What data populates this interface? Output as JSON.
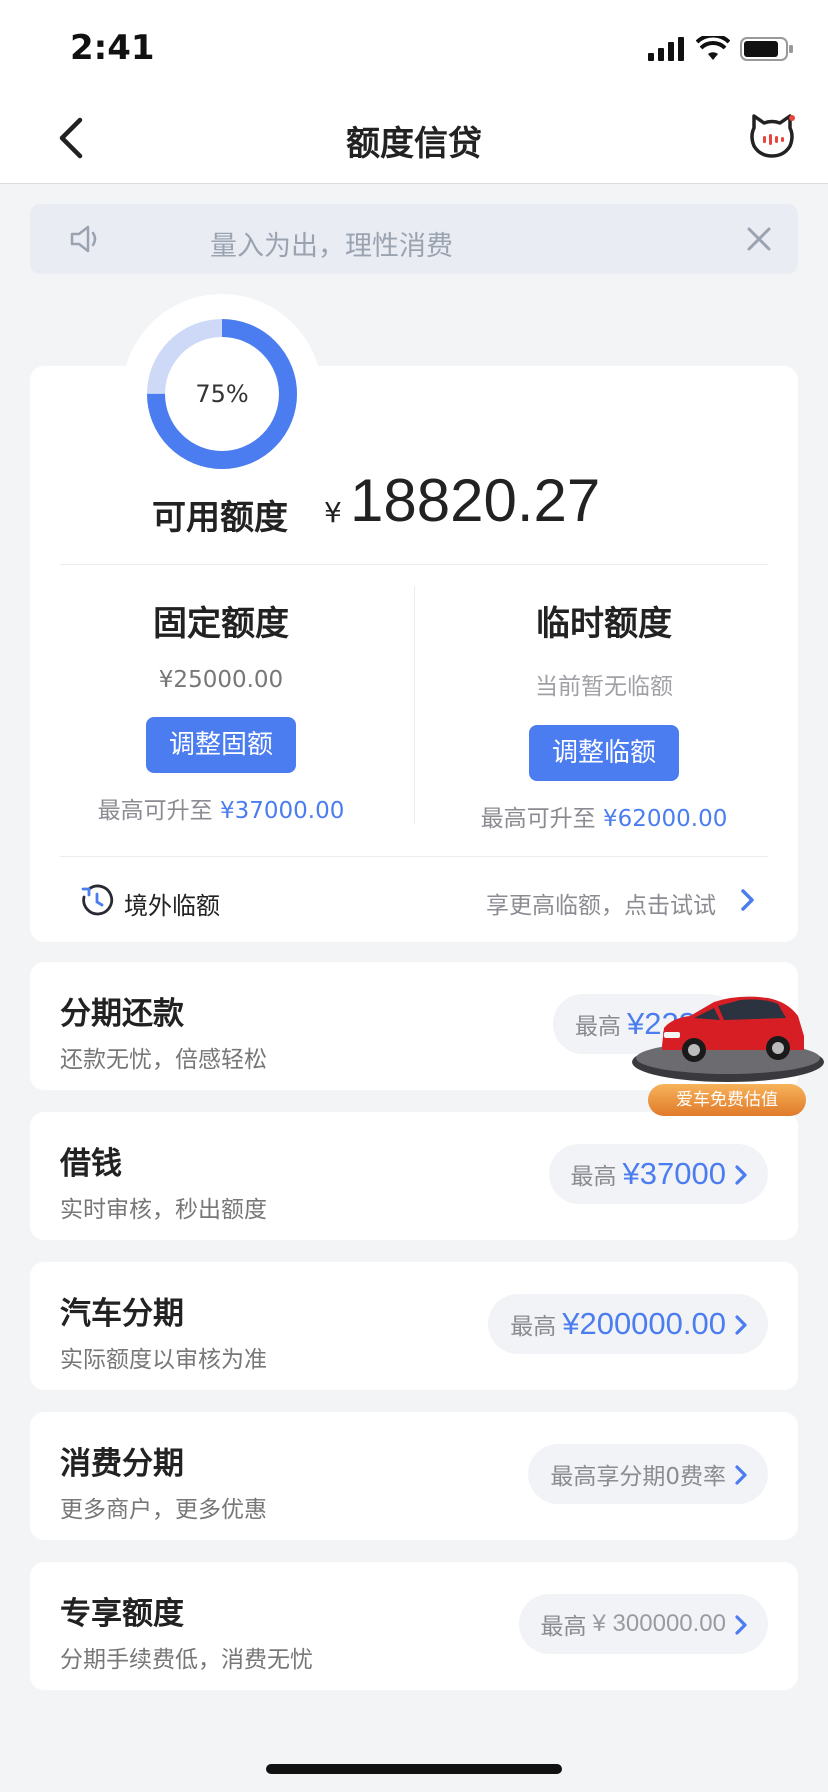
{
  "status_bar": {
    "time": "2:41"
  },
  "nav": {
    "title": "额度信贷"
  },
  "notice": {
    "text": "量入为出，理性消费"
  },
  "credit": {
    "ring_label": "75%",
    "ring_fraction": 0.75,
    "available_label": "可用额度",
    "currency": "¥",
    "available_amount": "18820.27",
    "fixed": {
      "title": "固定额度",
      "amount": "¥25000.00",
      "button": "调整固额",
      "max_prefix": "最高可升至",
      "max_amount": "¥37000.00"
    },
    "temporary": {
      "title": "临时额度",
      "amount": "当前暂无临额",
      "button": "调整临额",
      "max_prefix": "最高可升至",
      "max_amount": "¥62000.00"
    },
    "overseas": {
      "label": "境外临额",
      "hint": "享更高临额，点击试试"
    }
  },
  "products": [
    {
      "title": "分期还款",
      "subtitle": "还款无忧，倍感轻松",
      "pill_label": "最高",
      "pill_amount": "¥223"
    },
    {
      "title": "借钱",
      "subtitle": "实时审核，秒出额度",
      "pill_label": "最高",
      "pill_amount": "¥37000"
    },
    {
      "title": "汽车分期",
      "subtitle": "实际额度以审核为准",
      "pill_label": "最高",
      "pill_amount": "¥200000.00"
    },
    {
      "title": "消费分期",
      "subtitle": "更多商户，更多优惠",
      "pill_text": "最高享分期0费率"
    },
    {
      "title": "专享额度",
      "subtitle": "分期手续费低，消费无忧",
      "pill_label": "最高",
      "pill_amount": "¥ 300000.00"
    }
  ],
  "promo": {
    "tag": "爱车免费估值"
  },
  "colors": {
    "accent": "#4b7df0",
    "ring_track": "#cdd9f6",
    "background": "#f3f4f6"
  }
}
